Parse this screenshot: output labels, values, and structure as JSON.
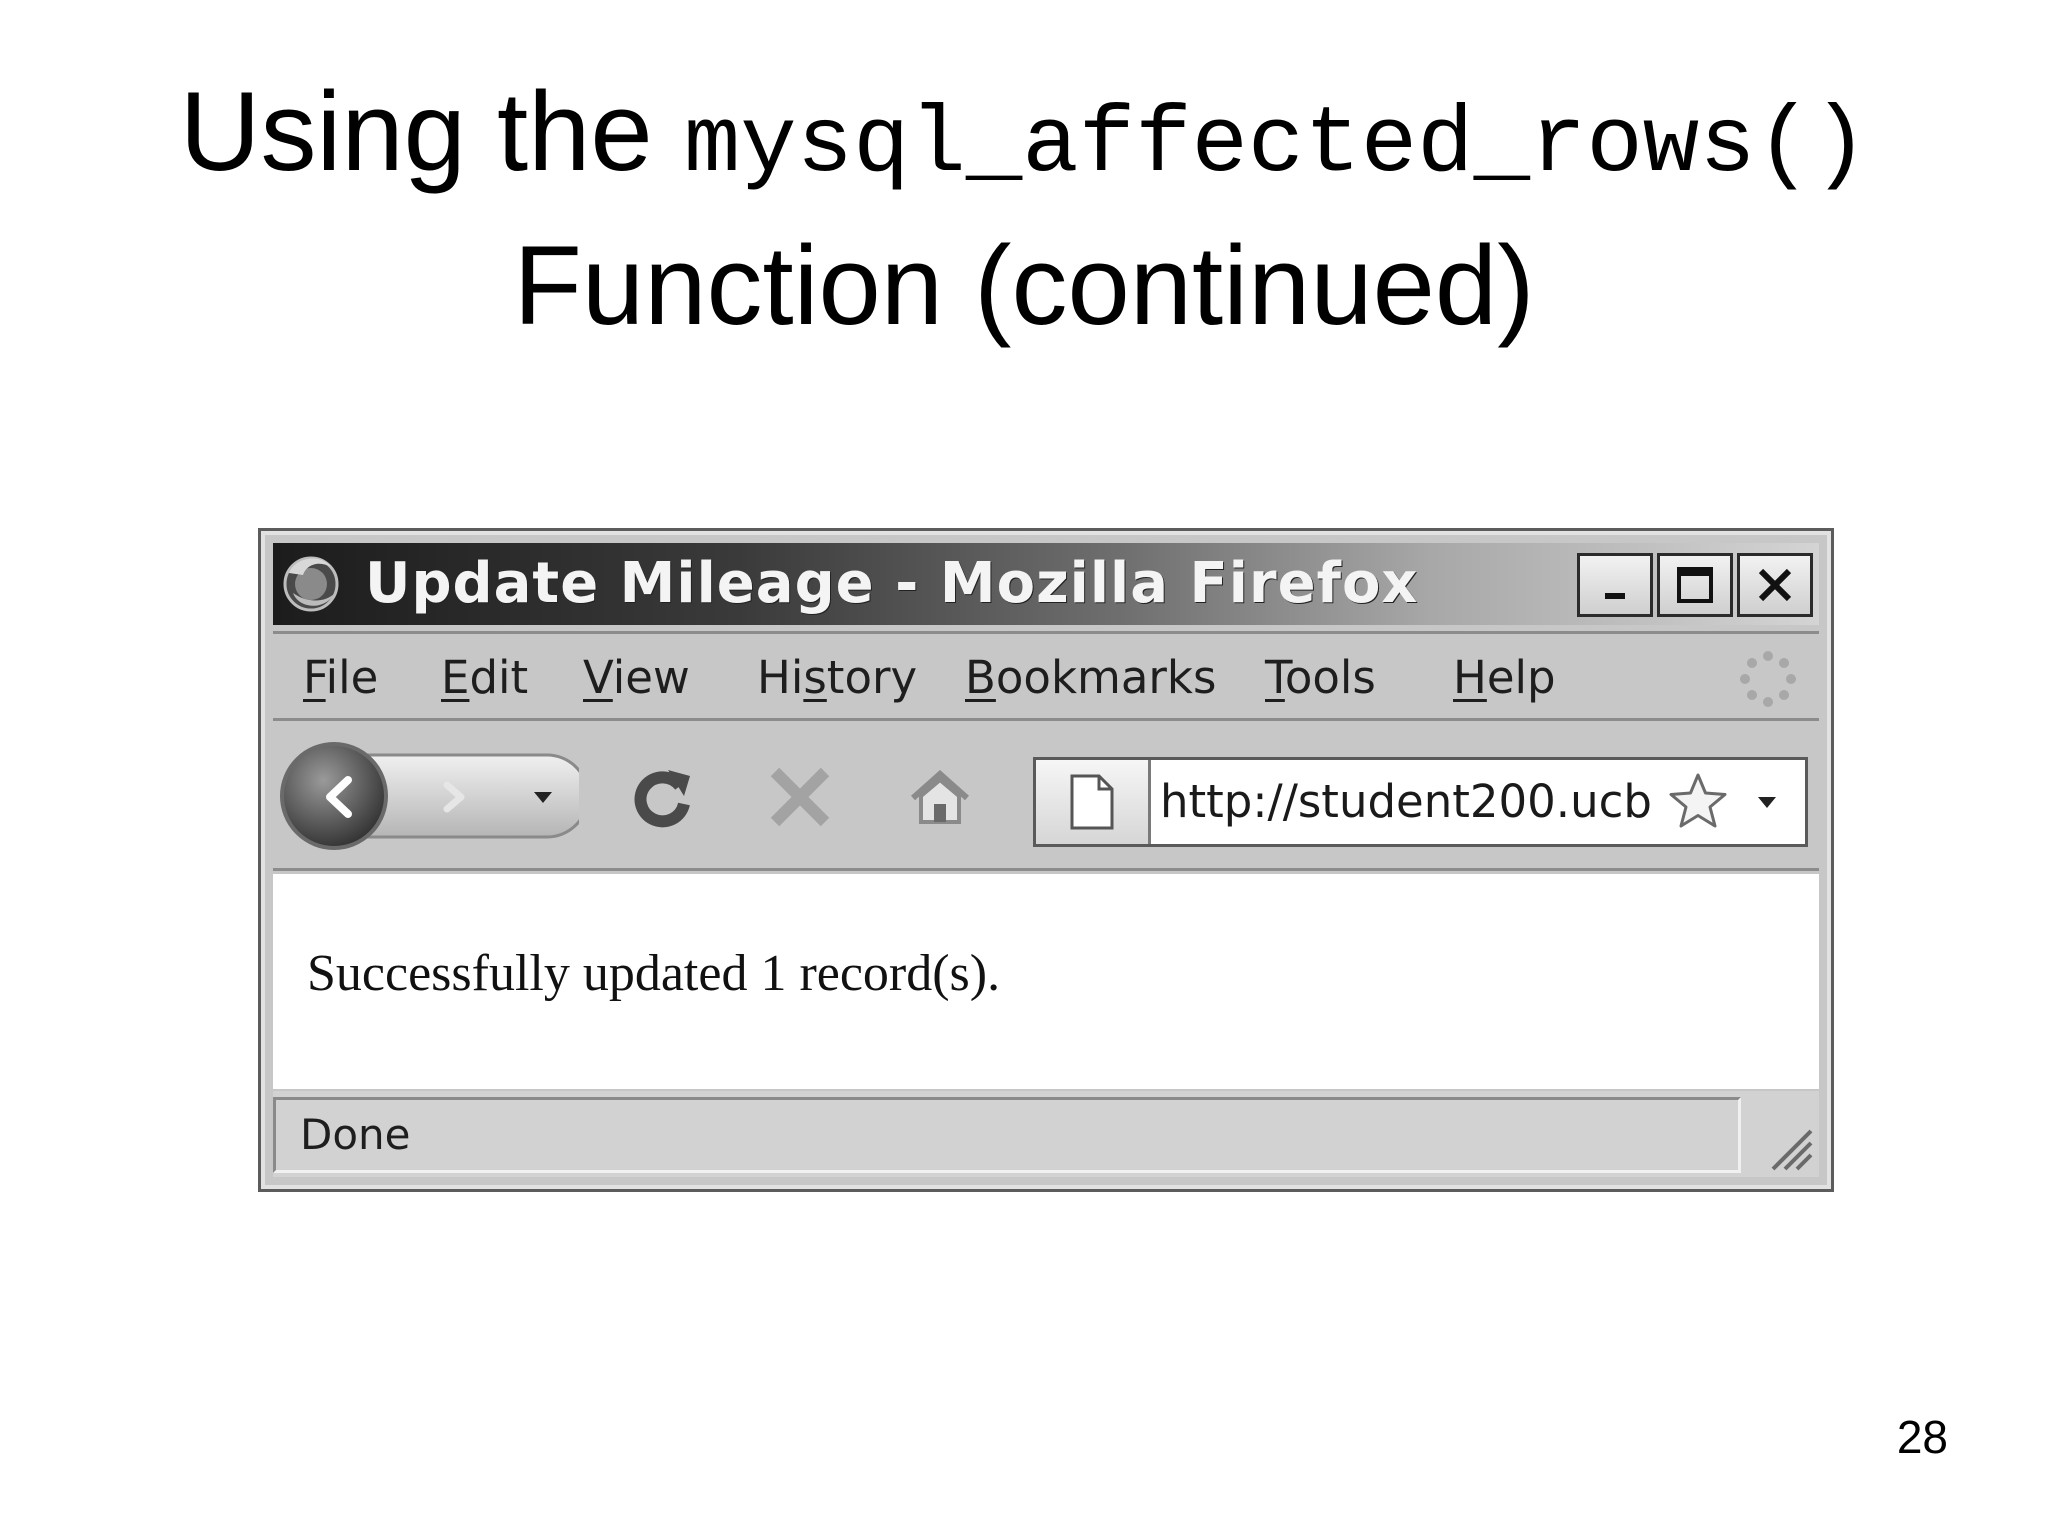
{
  "slide": {
    "title_prefix": "Using the",
    "title_code": "mysql_affected_rows()",
    "title_line2": "Function (continued)",
    "page_number": "28"
  },
  "window": {
    "title": "Update Mileage - Mozilla Firefox",
    "app_icon": "firefox-logo-icon",
    "controls": [
      "minimize-icon",
      "maximize-icon",
      "close-icon"
    ]
  },
  "menu": {
    "items": [
      {
        "pre": "",
        "key": "F",
        "post": "ile"
      },
      {
        "pre": "",
        "key": "E",
        "post": "dit"
      },
      {
        "pre": "",
        "key": "V",
        "post": "iew"
      },
      {
        "pre": "Hi",
        "key": "s",
        "post": "tory"
      },
      {
        "pre": "",
        "key": "B",
        "post": "ookmarks"
      },
      {
        "pre": "",
        "key": "T",
        "post": "ools"
      },
      {
        "pre": "",
        "key": "H",
        "post": "elp"
      }
    ],
    "throbber_icon": "loading-throbber-icon"
  },
  "toolbar": {
    "icons": [
      "back-arrow-icon",
      "forward-arrow-icon",
      "history-dropdown-icon",
      "reload-icon",
      "stop-icon",
      "home-icon"
    ]
  },
  "address": {
    "url": "http://student200.ucb",
    "page_icon": "page-icon",
    "bookmark_icon": "star-icon"
  },
  "content": {
    "message": "Successfully updated 1 record(s)."
  },
  "status": {
    "text": "Done"
  }
}
